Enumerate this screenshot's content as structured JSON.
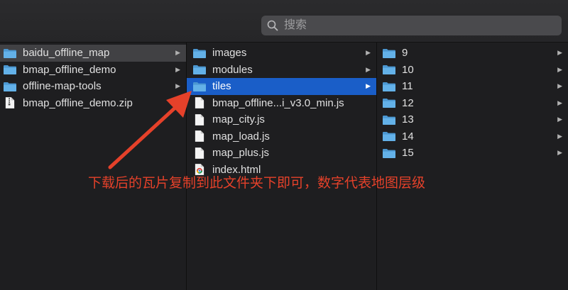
{
  "search": {
    "placeholder": "搜索"
  },
  "column1": [
    {
      "name": "baidu_offline_map",
      "kind": "folder",
      "has_children": true,
      "selected": "gray"
    },
    {
      "name": "bmap_offline_demo",
      "kind": "folder",
      "has_children": true
    },
    {
      "name": "offline-map-tools",
      "kind": "folder",
      "has_children": true
    },
    {
      "name": "bmap_offline_demo.zip",
      "kind": "zip",
      "has_children": false
    }
  ],
  "column2": [
    {
      "name": "images",
      "kind": "folder",
      "has_children": true
    },
    {
      "name": "modules",
      "kind": "folder",
      "has_children": true
    },
    {
      "name": "tiles",
      "kind": "folder",
      "has_children": true,
      "selected": "blue"
    },
    {
      "name": "bmap_offline...i_v3.0_min.js",
      "kind": "file",
      "has_children": false
    },
    {
      "name": "map_city.js",
      "kind": "file",
      "has_children": false
    },
    {
      "name": "map_load.js",
      "kind": "file",
      "has_children": false
    },
    {
      "name": "map_plus.js",
      "kind": "file",
      "has_children": false
    },
    {
      "name": "index.html",
      "kind": "html",
      "has_children": false
    }
  ],
  "column3": [
    {
      "name": "9",
      "kind": "folder",
      "has_children": true
    },
    {
      "name": "10",
      "kind": "folder",
      "has_children": true
    },
    {
      "name": "11",
      "kind": "folder",
      "has_children": true
    },
    {
      "name": "12",
      "kind": "folder",
      "has_children": true
    },
    {
      "name": "13",
      "kind": "folder",
      "has_children": true
    },
    {
      "name": "14",
      "kind": "folder",
      "has_children": true
    },
    {
      "name": "15",
      "kind": "folder",
      "has_children": true
    }
  ],
  "annotation": {
    "text": "下载后的瓦片复制到此文件夹下即可，数字代表地图层级"
  },
  "colors": {
    "folder": "#5aa9e0",
    "selection_blue": "#1a5ec8",
    "selection_gray": "#414144",
    "annotation": "#e5412a"
  }
}
